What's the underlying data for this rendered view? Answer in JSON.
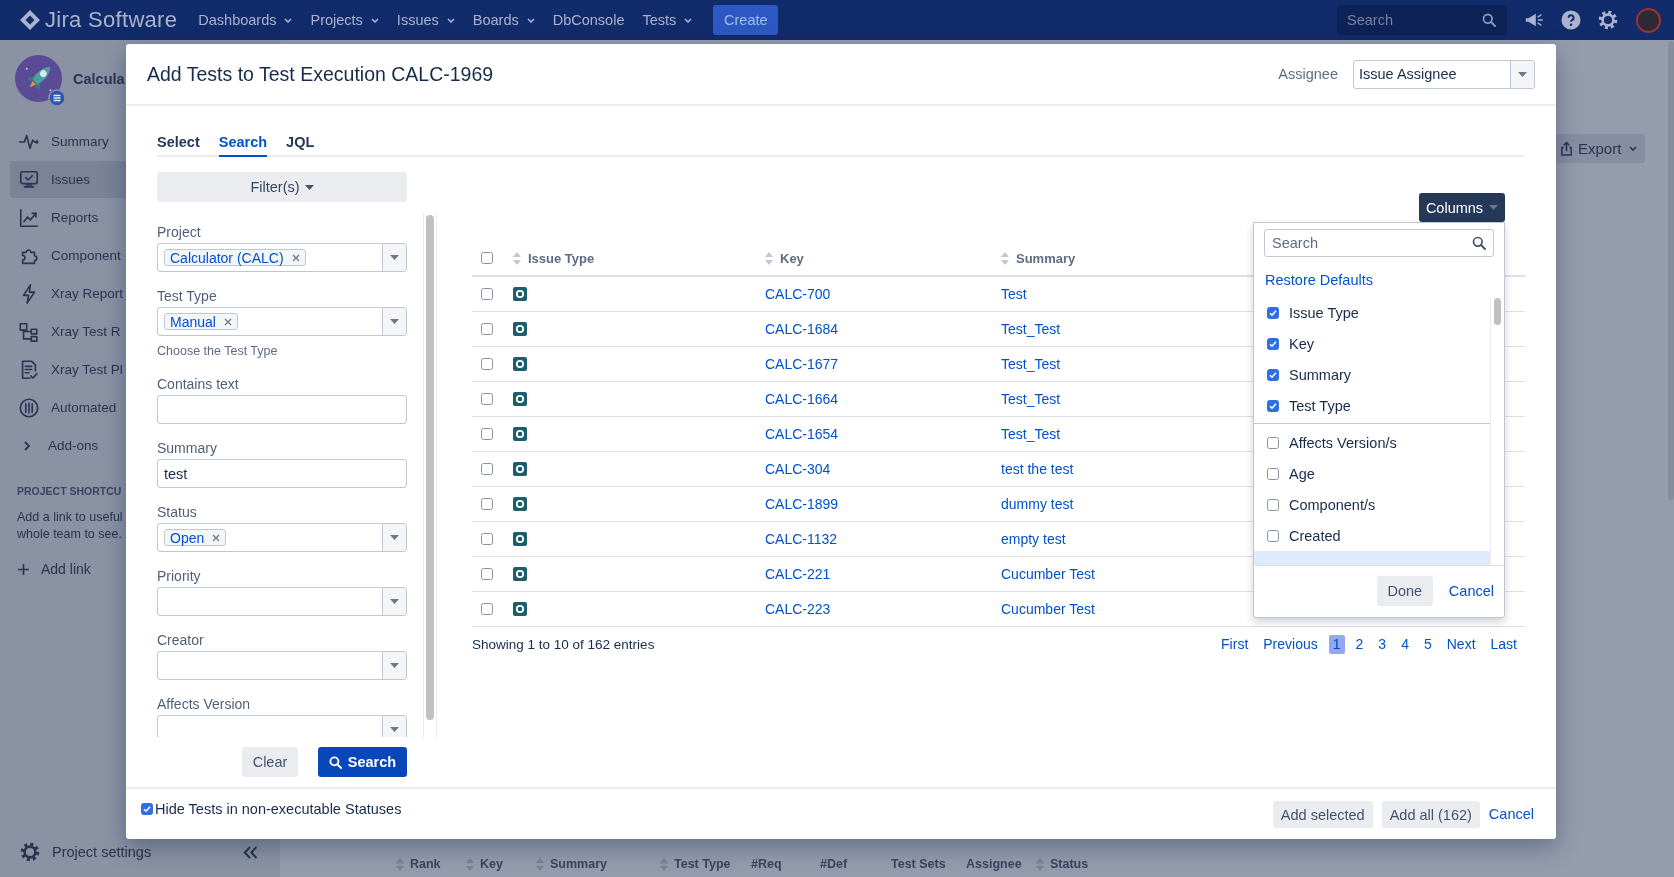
{
  "top_nav": {
    "logo": "Jira Software",
    "items": [
      {
        "label": "Dashboards",
        "menu": true
      },
      {
        "label": "Projects",
        "menu": true
      },
      {
        "label": "Issues",
        "menu": true
      },
      {
        "label": "Boards",
        "menu": true
      },
      {
        "label": "DbConsole",
        "menu": false
      },
      {
        "label": "Tests",
        "menu": true
      }
    ],
    "create_button": "Create",
    "search": {
      "placeholder": "Search"
    }
  },
  "sidebar": {
    "project_name": "Calcula",
    "items": [
      {
        "label": "Summary",
        "selected": false
      },
      {
        "label": "Issues",
        "selected": true
      },
      {
        "label": "Reports",
        "selected": false
      },
      {
        "label": "Component",
        "selected": false
      },
      {
        "label": "Xray Report",
        "selected": false
      },
      {
        "label": "Xray Test R",
        "selected": false
      },
      {
        "label": "Xray Test Pl",
        "selected": false
      },
      {
        "label": "Automated",
        "selected": false
      }
    ],
    "addons": "Add-ons",
    "shortcuts": {
      "heading": "PROJECT SHORTCU",
      "hint_lines": [
        "Add a link to useful",
        "whole team to see."
      ],
      "add_link": "Add link"
    },
    "settings": "Project settings"
  },
  "page": {
    "export_button": "Export",
    "table_columns": [
      {
        "label": "Rank",
        "sortable": true
      },
      {
        "label": "Key",
        "sortable": true
      },
      {
        "label": "Summary",
        "sortable": true
      },
      {
        "label": "Test Type",
        "sortable": true
      },
      {
        "label": "#Req",
        "sortable": false
      },
      {
        "label": "#Def",
        "sortable": false
      },
      {
        "label": "Test Sets",
        "sortable": false
      },
      {
        "label": "Assignee",
        "sortable": false
      },
      {
        "label": "Status",
        "sortable": true
      }
    ]
  },
  "dialog": {
    "title": "Add Tests to Test Execution CALC-1969",
    "assignee": {
      "label": "Assignee",
      "value": "Issue Assignee"
    },
    "tabs": [
      {
        "label": "Select",
        "selected": false
      },
      {
        "label": "Search",
        "selected": true
      },
      {
        "label": "JQL",
        "selected": false
      }
    ],
    "filters_button": "Filter(s)",
    "fields": [
      {
        "kind": "select",
        "label": "Project",
        "tags": [
          "Calculator (CALC)"
        ]
      },
      {
        "kind": "select",
        "label": "Test Type",
        "tags": [
          "Manual"
        ],
        "hint": "Choose the Test Type"
      },
      {
        "kind": "input",
        "label": "Contains text"
      },
      {
        "kind": "input",
        "label": "Summary",
        "value": "test"
      },
      {
        "kind": "select",
        "label": "Status",
        "tags": [
          "Open"
        ]
      },
      {
        "kind": "select",
        "label": "Priority"
      },
      {
        "kind": "select",
        "label": "Creator"
      },
      {
        "kind": "select",
        "label": "Affects Version"
      }
    ],
    "clear_button": "Clear",
    "search_button": "Search",
    "columns_button": "Columns",
    "columns_menu": {
      "search": {
        "placeholder": "Search"
      },
      "restore_link": "Restore Defaults",
      "groups": [
        {
          "items": [
            {
              "label": "Issue Type",
              "checked": true
            },
            {
              "label": "Key",
              "checked": true
            },
            {
              "label": "Summary",
              "checked": true
            },
            {
              "label": "Test Type",
              "checked": true
            }
          ]
        },
        {
          "items": [
            {
              "label": "Affects Version/s",
              "checked": false
            },
            {
              "label": "Age",
              "checked": false
            },
            {
              "label": "Component/s",
              "checked": false
            },
            {
              "label": "Created",
              "checked": false
            }
          ]
        }
      ],
      "cut_off_item": {
        "highlighted": true
      },
      "done_button": "Done",
      "cancel_link": "Cancel"
    },
    "table": {
      "select_all_checked": false,
      "columns": [
        {
          "label": "Issue Type",
          "sortable": true
        },
        {
          "label": "Key",
          "sortable": true
        },
        {
          "label": "Summary",
          "sortable": true
        }
      ],
      "rows": [
        {
          "checked": false,
          "key": "CALC-700",
          "summary": "Test"
        },
        {
          "checked": false,
          "key": "CALC-1684",
          "summary": "Test_Test"
        },
        {
          "checked": false,
          "key": "CALC-1677",
          "summary": "Test_Test"
        },
        {
          "checked": false,
          "key": "CALC-1664",
          "summary": "Test_Test"
        },
        {
          "checked": false,
          "key": "CALC-1654",
          "summary": "Test_Test"
        },
        {
          "checked": false,
          "key": "CALC-304",
          "summary": "test the test"
        },
        {
          "checked": false,
          "key": "CALC-1899",
          "summary": "dummy test"
        },
        {
          "checked": false,
          "key": "CALC-1132",
          "summary": "empty test"
        },
        {
          "checked": false,
          "key": "CALC-221",
          "summary": "Cucumber Test"
        },
        {
          "checked": false,
          "key": "CALC-223",
          "summary": "Cucumber Test"
        }
      ]
    },
    "entries_text": "Showing 1 to 10 of 162 entries",
    "pagination": [
      {
        "label": "First",
        "selected": false
      },
      {
        "label": "Previous",
        "selected": false
      },
      {
        "label": "1",
        "selected": true
      },
      {
        "label": "2",
        "selected": false
      },
      {
        "label": "3",
        "selected": false
      },
      {
        "label": "4",
        "selected": false
      },
      {
        "label": "5",
        "selected": false
      },
      {
        "label": "Next",
        "selected": false
      },
      {
        "label": "Last",
        "selected": false
      }
    ],
    "footer": {
      "hide_statuses": {
        "label": "Hide Tests in non-executable Statuses",
        "checked": true
      },
      "buttons": [
        {
          "kind": "button",
          "label": "Add selected"
        },
        {
          "kind": "button",
          "label": "Add all (162)"
        },
        {
          "kind": "link",
          "label": "Cancel"
        }
      ]
    }
  }
}
